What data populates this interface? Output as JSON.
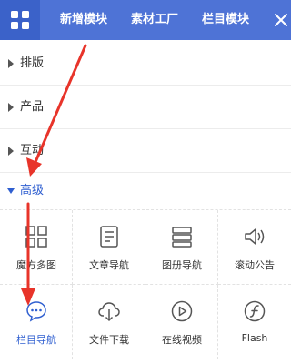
{
  "header": {
    "tabs": [
      {
        "label": "新增模块"
      },
      {
        "label": "素材工厂"
      },
      {
        "label": "栏目模块"
      }
    ]
  },
  "categories": [
    {
      "label": "排版"
    },
    {
      "label": "产品"
    },
    {
      "label": "互动"
    },
    {
      "label": "高级"
    }
  ],
  "widgets": [
    {
      "label": "魔方多图",
      "icon": "cube-grid-icon"
    },
    {
      "label": "文章导航",
      "icon": "article-list-icon"
    },
    {
      "label": "图册导航",
      "icon": "album-stack-icon"
    },
    {
      "label": "滚动公告",
      "icon": "speaker-icon"
    },
    {
      "label": "栏目导航",
      "icon": "chat-bubble-icon"
    },
    {
      "label": "文件下载",
      "icon": "cloud-download-icon"
    },
    {
      "label": "在线视频",
      "icon": "play-circle-icon"
    },
    {
      "label": "Flash",
      "icon": "flash-icon"
    }
  ],
  "colors": {
    "header_bg": "#4e73d6",
    "active": "#2f5fd0",
    "annotation": "#e8342a"
  }
}
